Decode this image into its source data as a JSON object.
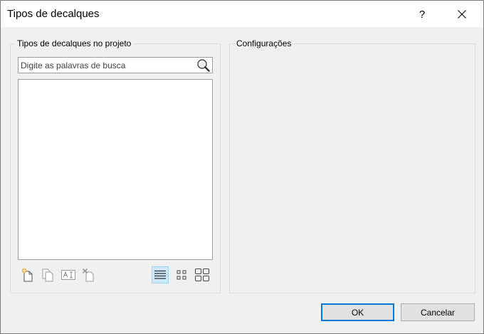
{
  "window": {
    "title": "Tipos de decalques",
    "help_label": "?"
  },
  "left_panel": {
    "label": "Tipos de decalques no projeto",
    "search_placeholder": "Digite as palavras de busca",
    "items": []
  },
  "right_panel": {
    "label": "Configurações"
  },
  "toolbar": {
    "tools": [
      "new-type-icon",
      "duplicate-icon",
      "rename-icon",
      "delete-icon",
      "list-view-icon",
      "small-icons-view-icon",
      "large-icons-view-icon"
    ],
    "active_tool": "list-view-icon"
  },
  "footer": {
    "ok_label": "OK",
    "cancel_label": "Cancelar"
  },
  "colors": {
    "accent": "#0078d7",
    "active_tool_bg": "#cce8ff",
    "window_bg": "#f0f0f0"
  }
}
